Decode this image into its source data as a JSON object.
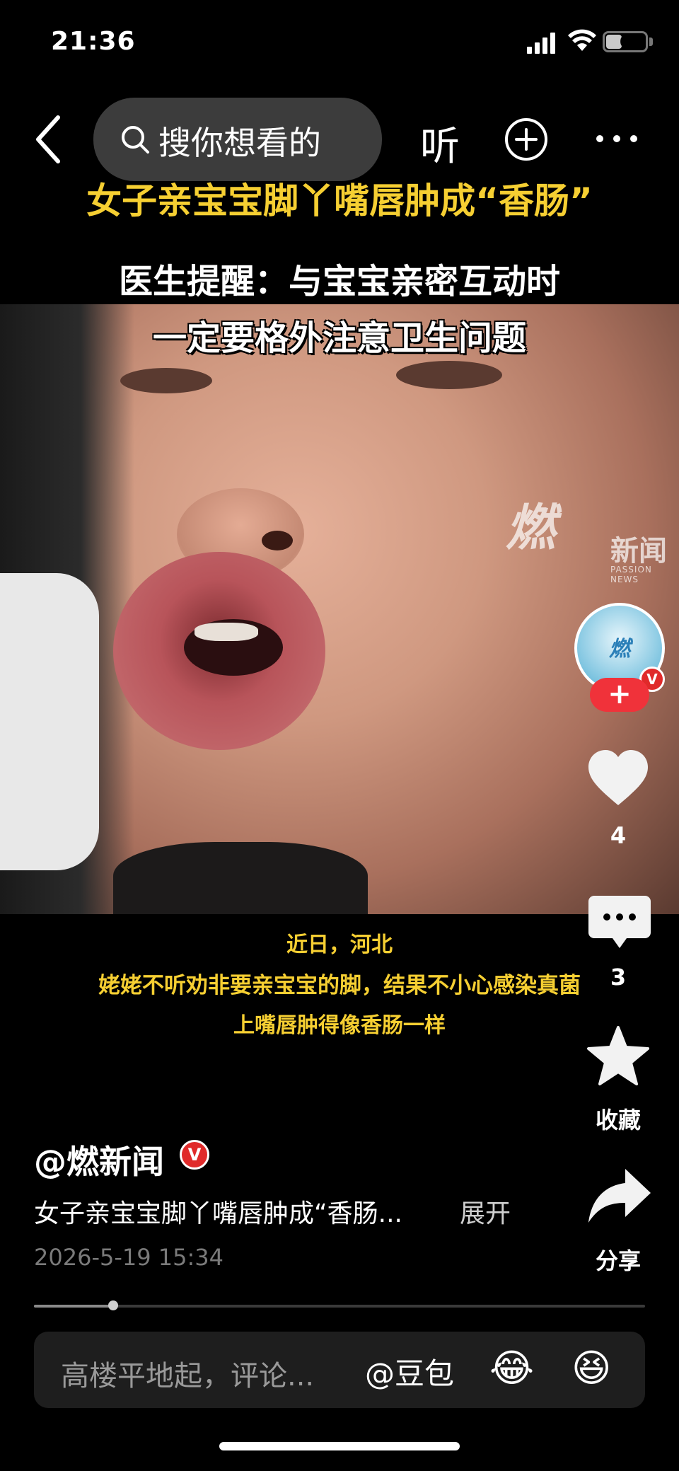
{
  "status_bar": {
    "time": "21:36",
    "battery": "6"
  },
  "nav": {
    "search_placeholder": "搜你想看的",
    "listen_label": "听"
  },
  "video": {
    "headline_1": "女子亲宝宝脚丫嘴唇肿成“香肠”",
    "headline_2": "医生提醒：与宝宝亲密互动时",
    "headline_3": "一定要格外注意卫生问题",
    "watermark_mark": "燃",
    "watermark_word": "新闻",
    "watermark_sub": "PASSION NEWS",
    "caption_1": "近日，河北",
    "caption_2": "姥姥不听劝非要亲宝宝的脚，结果不小心感染真菌",
    "caption_3": "上嘴唇肿得像香肠一样"
  },
  "rail": {
    "avatar_text": "燃",
    "verified_mark": "V",
    "follow_label": "+",
    "like_count": "4",
    "comment_count": "3",
    "favorite_label": "收藏",
    "share_label": "分享"
  },
  "post": {
    "author": "@燃新闻",
    "author_badge": "V",
    "description": "女子亲宝宝脚丫嘴唇肿成“香肠...",
    "expand_label": "展开",
    "time": "2026-5-19 15:34",
    "progress": 0.13
  },
  "comment_bar": {
    "placeholder": "高楼平地起，评论...",
    "mention_label": "@豆包",
    "emoji_1": "😂",
    "emoji_2": "😆"
  },
  "colors": {
    "accent_yellow": "#f6cf32",
    "follow_red": "#f0323a",
    "badge_red": "#e02a2a"
  },
  "icons": [
    "back-icon",
    "search-icon",
    "add-circle-icon",
    "more-icon",
    "heart-icon",
    "comment-icon",
    "star-icon",
    "share-icon"
  ]
}
